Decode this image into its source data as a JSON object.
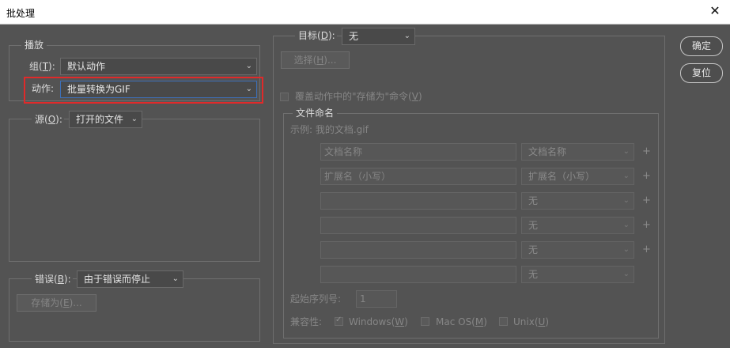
{
  "window": {
    "title": "批处理",
    "close_glyph": "✕"
  },
  "buttons": {
    "ok": "确定",
    "reset": "复位"
  },
  "play": {
    "legend": "播放",
    "set_label_pre": "组(",
    "set_key": "T",
    "set_label_post": "):",
    "set_value": "默认动作",
    "action_label": "动作:",
    "action_value": "批量转换为GIF"
  },
  "source": {
    "label_pre": "源(",
    "key": "O",
    "label_post": "):",
    "value": "打开的文件"
  },
  "errors": {
    "label_pre": "错误(",
    "key": "B",
    "label_post": "):",
    "value": "由于错误而停止",
    "save_as_pre": "存储为(",
    "save_as_key": "E",
    "save_as_post": ")..."
  },
  "destination": {
    "label_pre": "目标(",
    "key": "D",
    "label_post": "):",
    "value": "无",
    "choose_pre": "选择(",
    "choose_key": "H",
    "choose_post": ")...",
    "override_pre": "覆盖动作中的\"存储为\"命令(",
    "override_key": "V",
    "override_post": ")"
  },
  "file_naming": {
    "legend": "文件命名",
    "example": "示例: 我的文档.gif",
    "rows": [
      {
        "input": "文档名称",
        "select": "文档名称",
        "plus": "+"
      },
      {
        "input": "扩展名（小写）",
        "select": "扩展名（小写）",
        "plus": "+"
      },
      {
        "input": "",
        "select": "无",
        "plus": "+"
      },
      {
        "input": "",
        "select": "无",
        "plus": "+"
      },
      {
        "input": "",
        "select": "无",
        "plus": "+"
      },
      {
        "input": "",
        "select": "无",
        "plus": ""
      }
    ],
    "serial_label": "起始序列号:",
    "serial_value": "1",
    "compat_label": "兼容性:",
    "compat": [
      {
        "pre": "Windows(",
        "key": "W",
        "post": ")",
        "checked": true
      },
      {
        "pre": "Mac OS(",
        "key": "M",
        "post": ")",
        "checked": false
      },
      {
        "pre": "Unix(",
        "key": "U",
        "post": ")",
        "checked": false
      }
    ]
  },
  "colors": {
    "highlight": "#e02a2a",
    "background": "#535353"
  }
}
